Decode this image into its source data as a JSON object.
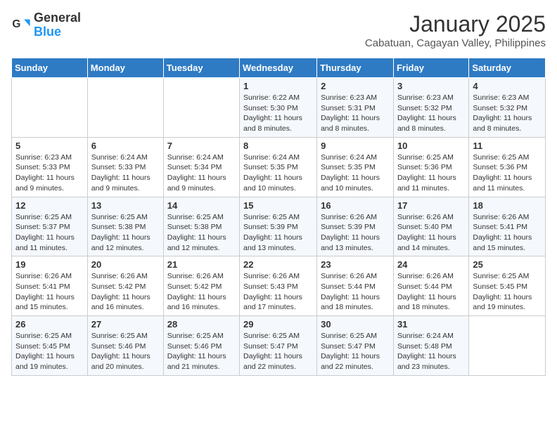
{
  "header": {
    "logo_line1": "General",
    "logo_line2": "Blue",
    "month": "January 2025",
    "location": "Cabatuan, Cagayan Valley, Philippines"
  },
  "days_of_week": [
    "Sunday",
    "Monday",
    "Tuesday",
    "Wednesday",
    "Thursday",
    "Friday",
    "Saturday"
  ],
  "weeks": [
    [
      {
        "day": "",
        "info": ""
      },
      {
        "day": "",
        "info": ""
      },
      {
        "day": "",
        "info": ""
      },
      {
        "day": "1",
        "info": "Sunrise: 6:22 AM\nSunset: 5:30 PM\nDaylight: 11 hours and 8 minutes."
      },
      {
        "day": "2",
        "info": "Sunrise: 6:23 AM\nSunset: 5:31 PM\nDaylight: 11 hours and 8 minutes."
      },
      {
        "day": "3",
        "info": "Sunrise: 6:23 AM\nSunset: 5:32 PM\nDaylight: 11 hours and 8 minutes."
      },
      {
        "day": "4",
        "info": "Sunrise: 6:23 AM\nSunset: 5:32 PM\nDaylight: 11 hours and 8 minutes."
      }
    ],
    [
      {
        "day": "5",
        "info": "Sunrise: 6:23 AM\nSunset: 5:33 PM\nDaylight: 11 hours and 9 minutes."
      },
      {
        "day": "6",
        "info": "Sunrise: 6:24 AM\nSunset: 5:33 PM\nDaylight: 11 hours and 9 minutes."
      },
      {
        "day": "7",
        "info": "Sunrise: 6:24 AM\nSunset: 5:34 PM\nDaylight: 11 hours and 9 minutes."
      },
      {
        "day": "8",
        "info": "Sunrise: 6:24 AM\nSunset: 5:35 PM\nDaylight: 11 hours and 10 minutes."
      },
      {
        "day": "9",
        "info": "Sunrise: 6:24 AM\nSunset: 5:35 PM\nDaylight: 11 hours and 10 minutes."
      },
      {
        "day": "10",
        "info": "Sunrise: 6:25 AM\nSunset: 5:36 PM\nDaylight: 11 hours and 11 minutes."
      },
      {
        "day": "11",
        "info": "Sunrise: 6:25 AM\nSunset: 5:36 PM\nDaylight: 11 hours and 11 minutes."
      }
    ],
    [
      {
        "day": "12",
        "info": "Sunrise: 6:25 AM\nSunset: 5:37 PM\nDaylight: 11 hours and 11 minutes."
      },
      {
        "day": "13",
        "info": "Sunrise: 6:25 AM\nSunset: 5:38 PM\nDaylight: 11 hours and 12 minutes."
      },
      {
        "day": "14",
        "info": "Sunrise: 6:25 AM\nSunset: 5:38 PM\nDaylight: 11 hours and 12 minutes."
      },
      {
        "day": "15",
        "info": "Sunrise: 6:25 AM\nSunset: 5:39 PM\nDaylight: 11 hours and 13 minutes."
      },
      {
        "day": "16",
        "info": "Sunrise: 6:26 AM\nSunset: 5:39 PM\nDaylight: 11 hours and 13 minutes."
      },
      {
        "day": "17",
        "info": "Sunrise: 6:26 AM\nSunset: 5:40 PM\nDaylight: 11 hours and 14 minutes."
      },
      {
        "day": "18",
        "info": "Sunrise: 6:26 AM\nSunset: 5:41 PM\nDaylight: 11 hours and 15 minutes."
      }
    ],
    [
      {
        "day": "19",
        "info": "Sunrise: 6:26 AM\nSunset: 5:41 PM\nDaylight: 11 hours and 15 minutes."
      },
      {
        "day": "20",
        "info": "Sunrise: 6:26 AM\nSunset: 5:42 PM\nDaylight: 11 hours and 16 minutes."
      },
      {
        "day": "21",
        "info": "Sunrise: 6:26 AM\nSunset: 5:42 PM\nDaylight: 11 hours and 16 minutes."
      },
      {
        "day": "22",
        "info": "Sunrise: 6:26 AM\nSunset: 5:43 PM\nDaylight: 11 hours and 17 minutes."
      },
      {
        "day": "23",
        "info": "Sunrise: 6:26 AM\nSunset: 5:44 PM\nDaylight: 11 hours and 18 minutes."
      },
      {
        "day": "24",
        "info": "Sunrise: 6:26 AM\nSunset: 5:44 PM\nDaylight: 11 hours and 18 minutes."
      },
      {
        "day": "25",
        "info": "Sunrise: 6:25 AM\nSunset: 5:45 PM\nDaylight: 11 hours and 19 minutes."
      }
    ],
    [
      {
        "day": "26",
        "info": "Sunrise: 6:25 AM\nSunset: 5:45 PM\nDaylight: 11 hours and 19 minutes."
      },
      {
        "day": "27",
        "info": "Sunrise: 6:25 AM\nSunset: 5:46 PM\nDaylight: 11 hours and 20 minutes."
      },
      {
        "day": "28",
        "info": "Sunrise: 6:25 AM\nSunset: 5:46 PM\nDaylight: 11 hours and 21 minutes."
      },
      {
        "day": "29",
        "info": "Sunrise: 6:25 AM\nSunset: 5:47 PM\nDaylight: 11 hours and 22 minutes."
      },
      {
        "day": "30",
        "info": "Sunrise: 6:25 AM\nSunset: 5:47 PM\nDaylight: 11 hours and 22 minutes."
      },
      {
        "day": "31",
        "info": "Sunrise: 6:24 AM\nSunset: 5:48 PM\nDaylight: 11 hours and 23 minutes."
      },
      {
        "day": "",
        "info": ""
      }
    ]
  ]
}
